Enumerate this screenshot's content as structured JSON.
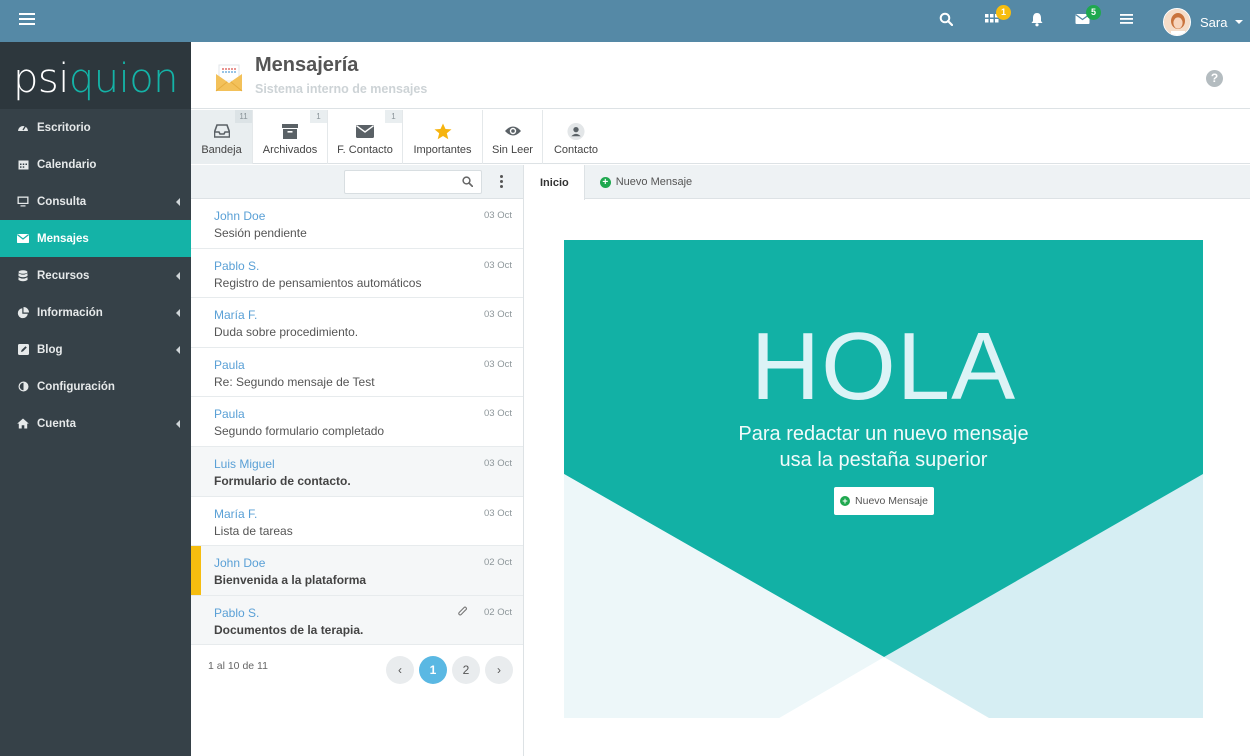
{
  "topbar": {
    "badges": {
      "apps": "1",
      "mail": "5"
    },
    "user_name": "Sara",
    "colors": {
      "bar": "#5589a6",
      "badge_apps": "#f6bd0f",
      "badge_mail": "#1fa84f"
    }
  },
  "logo": {
    "part1": "psi",
    "part2": "quion"
  },
  "sidebar": {
    "items": [
      {
        "label": "Escritorio",
        "icon": "dashboard-icon"
      },
      {
        "label": "Calendario",
        "icon": "calendar-icon"
      },
      {
        "label": "Consulta",
        "icon": "monitor-icon"
      },
      {
        "label": "Mensajes",
        "icon": "envelope-icon"
      },
      {
        "label": "Recursos",
        "icon": "database-icon"
      },
      {
        "label": "Información",
        "icon": "pie-chart-icon"
      },
      {
        "label": "Blog",
        "icon": "edit-icon"
      },
      {
        "label": "Configuración",
        "icon": "adjust-icon"
      },
      {
        "label": "Cuenta",
        "icon": "home-icon"
      }
    ],
    "active_color": "#14b3a7"
  },
  "header": {
    "title": "Mensajería",
    "subtitle": "Sistema interno de mensajes",
    "help": "?"
  },
  "folders": [
    {
      "label": "Bandeja",
      "count": "11",
      "icon": "inbox-icon"
    },
    {
      "label": "Archivados",
      "count": "1",
      "icon": "archive-icon"
    },
    {
      "label": "F. Contacto",
      "count": "1",
      "icon": "envelope-icon"
    },
    {
      "label": "Importantes",
      "count": "",
      "icon": "star-icon"
    },
    {
      "label": "Sin Leer",
      "count": "",
      "icon": "eye-icon"
    },
    {
      "label": "Contacto",
      "count": "",
      "icon": "user-icon"
    }
  ],
  "search": {
    "placeholder": ""
  },
  "messages": [
    {
      "from": "John Doe",
      "subject": "Sesión pendiente",
      "date": "03 Oct"
    },
    {
      "from": "Pablo S.",
      "subject": "Registro de pensamientos automáticos",
      "date": "03 Oct"
    },
    {
      "from": "María F.",
      "subject": "Duda sobre procedimiento.",
      "date": "03 Oct"
    },
    {
      "from": "Paula",
      "subject": "Re: Segundo mensaje de Test",
      "date": "03 Oct"
    },
    {
      "from": "Paula",
      "subject": "Segundo formulario completado",
      "date": "03 Oct"
    },
    {
      "from": "Luis Miguel",
      "subject": "Formulario de contacto.",
      "date": "03 Oct"
    },
    {
      "from": "María F.",
      "subject": "Lista de tareas",
      "date": "03 Oct"
    },
    {
      "from": "John Doe",
      "subject": "Bienvenida a la plataforma",
      "date": "02 Oct"
    },
    {
      "from": "Pablo S.",
      "subject": "Documentos de la terapia.",
      "date": "02 Oct"
    }
  ],
  "pagination": {
    "info": "1 al 10 de 11",
    "prev": "‹",
    "page1": "1",
    "page2": "2",
    "next": "›"
  },
  "tabs": {
    "inicio": "Inicio",
    "nuevo": "Nuevo Mensaje"
  },
  "banner": {
    "hola": "HOLA",
    "line1": "Para redactar un nuevo mensaje",
    "line2": "usa la pestaña superior",
    "button": "Nuevo Mensaje",
    "colors": {
      "teal": "#12b1a5",
      "light": "#d6eef3",
      "lighter": "#edf7f9"
    }
  }
}
